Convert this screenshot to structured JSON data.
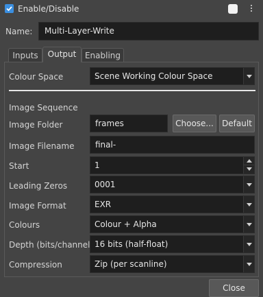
{
  "header": {
    "enable_label": "Enable/Disable"
  },
  "name": {
    "label": "Name:",
    "value": "Multi-Layer-Write"
  },
  "tabs": [
    {
      "label": "Inputs",
      "active": false
    },
    {
      "label": "Output",
      "active": true
    },
    {
      "label": "Enabling",
      "active": false
    }
  ],
  "output": {
    "colour_space": {
      "label": "Colour Space",
      "value": "Scene Working Colour Space"
    },
    "section_title": "Image Sequence",
    "image_folder": {
      "label": "Image Folder",
      "value": "frames",
      "choose_label": "Choose...",
      "default_label": "Default"
    },
    "image_filename": {
      "label": "Image Filename",
      "value": "final-"
    },
    "start": {
      "label": "Start",
      "value": "1"
    },
    "leading_zeros": {
      "label": "Leading Zeros",
      "value": "0001"
    },
    "image_format": {
      "label": "Image Format",
      "value": "EXR"
    },
    "colours": {
      "label": "Colours",
      "value": "Colour + Alpha"
    },
    "depth": {
      "label": "Depth (bits/channel)",
      "value": "16 bits (half-float)"
    },
    "compression": {
      "label": "Compression",
      "value": "Zip (per scanline)"
    }
  },
  "footer": {
    "close_label": "Close"
  }
}
